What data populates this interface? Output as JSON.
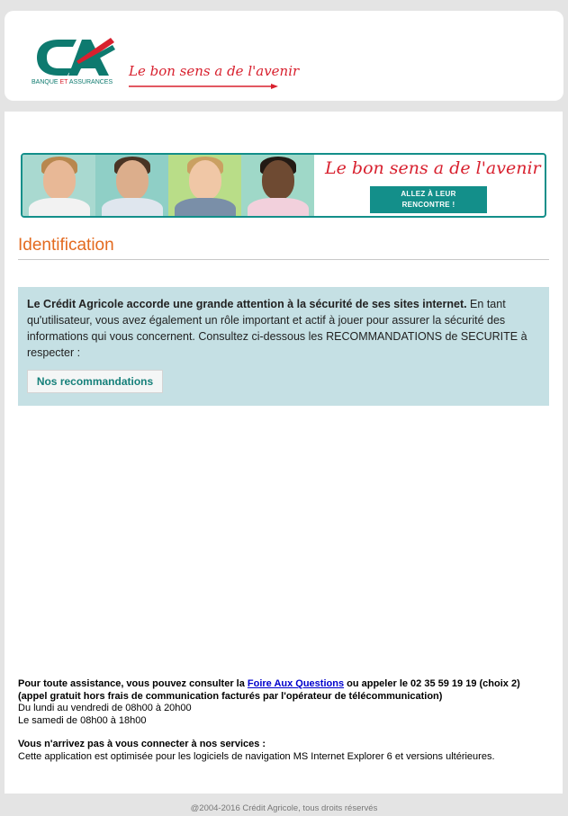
{
  "header": {
    "logo_sub_prefix": "BANQUE",
    "logo_sub_mid": "ET",
    "logo_sub_suffix": "ASSURANCES",
    "tagline": "Le bon sens a de l'avenir"
  },
  "banner": {
    "tagline": "Le bon sens a de l'avenir",
    "button_line1": "ALLEZ À LEUR",
    "button_line2": "RENCONTRE !"
  },
  "page_title": "Identification",
  "notice": {
    "bold_text": "Le Crédit Agricole accorde une grande attention à la sécurité de ses sites internet.",
    "text": " En tant qu'utilisateur, vous avez également un rôle important et actif à jouer pour assurer la sécurité des informations qui vous concernent. Consultez ci-dessous les RECOMMANDATIONS de SECURITE à respecter :",
    "button_label": "Nos recommandations"
  },
  "assistance": {
    "line1_prefix": "Pour toute assistance, vous pouvez consulter la ",
    "faq_link": "Foire Aux Questions",
    "line1_suffix": " ou appeler le 02 35 59 19 19 (choix 2)",
    "line2": "(appel gratuit hors frais de communication facturés par l'opérateur de télécommunication)",
    "hours_weekday": "Du lundi au vendredi de 08h00 à 20h00",
    "hours_saturday": "Le samedi de 08h00 à 18h00",
    "connect_title": "Vous n'arrivez pas à vous connecter à nos services :",
    "connect_text": "Cette application est optimisée pour les logiciels de navigation MS Internet Explorer 6 et versions ultérieures."
  },
  "footer": "@2004-2016 Crédit Agricole, tous droits réservés",
  "colors": {
    "brand_red": "#d8202e",
    "brand_teal": "#138f8a",
    "title_orange": "#e36a1f",
    "notice_bg": "#c5e0e4"
  }
}
